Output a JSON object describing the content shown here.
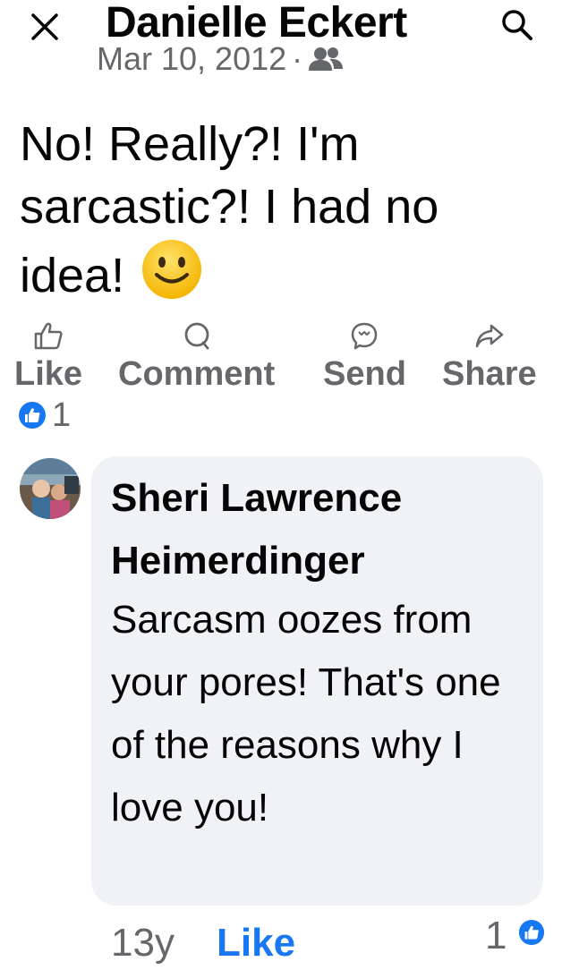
{
  "header": {
    "title": "Danielle Eckert",
    "close_icon": "close-icon",
    "search_icon": "search-icon"
  },
  "post": {
    "date": "Mar 10, 2012",
    "separator": "·",
    "audience_icon": "friends-icon",
    "text": "No!  Really?!  I'm sarcastic?!  I had no idea!",
    "emoji_icon": "smiling-face-emoji"
  },
  "actions": [
    {
      "label": "Like",
      "icon": "thumbs-up-icon"
    },
    {
      "label": "Comment",
      "icon": "comment-icon"
    },
    {
      "label": "Send",
      "icon": "messenger-icon"
    },
    {
      "label": "Share",
      "icon": "share-arrow-icon"
    }
  ],
  "reactions": {
    "icon": "like-reaction-icon",
    "count": "1",
    "color": "#1877f2"
  },
  "comment": {
    "author": "Sheri Lawrence Heimerdinger",
    "text": "Sarcasm oozes from your pores!  That's one of the reasons why I love you!",
    "age": "13y",
    "like_label": "Like",
    "reaction_count": "1",
    "reaction_icon": "like-reaction-icon"
  },
  "colors": {
    "accent": "#1877f2",
    "secondary_text": "#65676b",
    "bubble": "#f0f2f5"
  }
}
